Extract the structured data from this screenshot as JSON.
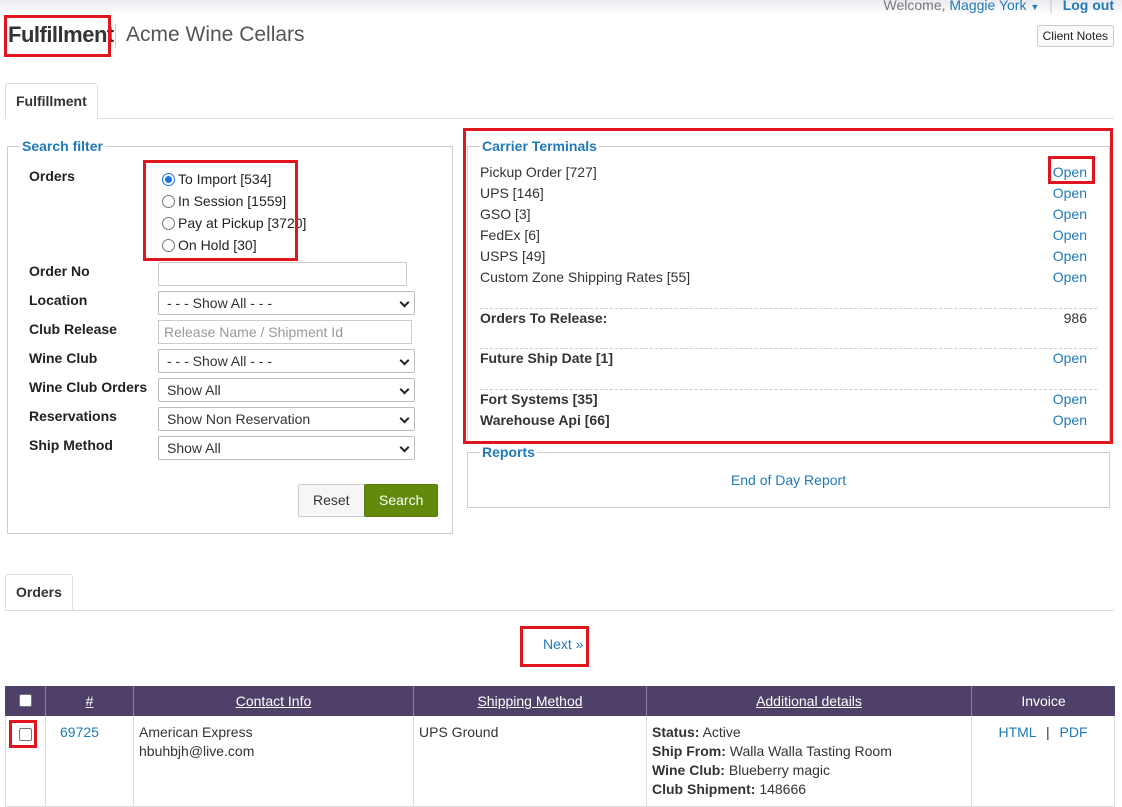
{
  "header": {
    "welcome": "Welcome,",
    "user": "Maggie York",
    "logout": "Log out",
    "brand": "Fulfillment",
    "client": "Acme Wine Cellars",
    "client_notes": "Client Notes"
  },
  "tabs": {
    "fulfillment": "Fulfillment",
    "orders": "Orders"
  },
  "search_filter": {
    "legend": "Search filter",
    "orders_label": "Orders",
    "order_options": [
      {
        "label": "To Import [534]",
        "checked": true
      },
      {
        "label": "In Session [1559]",
        "checked": false
      },
      {
        "label": "Pay at Pickup [3720]",
        "checked": false
      },
      {
        "label": "On Hold [30]",
        "checked": false
      }
    ],
    "order_no_label": "Order No",
    "order_no_value": "",
    "location_label": "Location",
    "location_value": "- - - Show All - - -",
    "club_release_label": "Club Release",
    "club_release_placeholder": "Release Name / Shipment Id",
    "wine_club_label": "Wine Club",
    "wine_club_value": "- - - Show All - - -",
    "wine_club_orders_label": "Wine Club Orders",
    "wine_club_orders_value": "Show All",
    "reservations_label": "Reservations",
    "reservations_value": "Show Non Reservation",
    "ship_method_label": "Ship Method",
    "ship_method_value": "Show All",
    "reset": "Reset",
    "search": "Search"
  },
  "carrier_terminals": {
    "legend": "Carrier Terminals",
    "carriers": [
      {
        "name": "Pickup Order [727]",
        "action": "Open"
      },
      {
        "name": "UPS [146]",
        "action": "Open"
      },
      {
        "name": "GSO [3]",
        "action": "Open"
      },
      {
        "name": "FedEx [6]",
        "action": "Open"
      },
      {
        "name": "USPS [49]",
        "action": "Open"
      },
      {
        "name": "Custom Zone Shipping Rates [55]",
        "action": "Open"
      }
    ],
    "orders_to_release_label": "Orders To Release:",
    "orders_to_release_value": "986",
    "future_ship_label": "Future Ship Date [1]",
    "future_ship_action": "Open",
    "fort_systems_label": "Fort Systems [35]",
    "fort_systems_action": "Open",
    "warehouse_api_label": "Warehouse Api [66]",
    "warehouse_api_action": "Open"
  },
  "reports": {
    "legend": "Reports",
    "end_of_day": "End of Day Report"
  },
  "pagination": {
    "next": "Next »"
  },
  "table": {
    "headers": {
      "number": "#",
      "contact": "Contact Info",
      "shipping": "Shipping Method",
      "additional": "Additional details",
      "invoice": "Invoice"
    },
    "rows": [
      {
        "order_no": "69725",
        "contact_name": "American Express",
        "contact_email": "hbuhbjh@live.com",
        "shipping_method": "UPS Ground",
        "status_label": "Status:",
        "status_value": "Active",
        "ship_from_label": "Ship From:",
        "ship_from_value": "Walla Walla Tasting Room",
        "wine_club_label": "Wine Club:",
        "wine_club_value": "Blueberry magic",
        "club_shipment_label": "Club Shipment:",
        "club_shipment_value": "148666",
        "invoice_html": "HTML",
        "invoice_sep": "|",
        "invoice_pdf": "PDF"
      }
    ]
  },
  "colors": {
    "accent": "#1f7ab8",
    "table_header": "#4e4068",
    "search_button": "#638a0d",
    "highlight": "#e0161e"
  }
}
